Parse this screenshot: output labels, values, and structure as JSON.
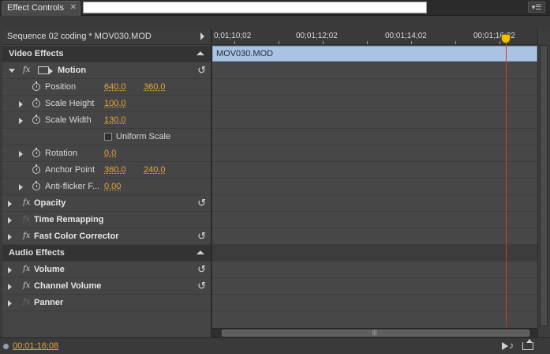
{
  "tab": {
    "title": "Effect Controls",
    "close": "✕",
    "menu": "▾☰"
  },
  "sequence": {
    "label": "Sequence 02 coding * MOV030.MOD"
  },
  "sections": {
    "video": "Video Effects",
    "audio": "Audio Effects"
  },
  "effects": {
    "motion": {
      "name": "Motion"
    },
    "opacity": {
      "name": "Opacity"
    },
    "time_remapping": {
      "name": "Time Remapping"
    },
    "fast_color": {
      "name": "Fast Color Corrector"
    },
    "volume": {
      "name": "Volume"
    },
    "channel_volume": {
      "name": "Channel Volume"
    },
    "panner": {
      "name": "Panner"
    }
  },
  "fx_label": "fx",
  "reset_glyph": "↺",
  "params": {
    "position": {
      "label": "Position",
      "v1": "640.0",
      "v2": "360.0"
    },
    "scale_height": {
      "label": "Scale Height",
      "v1": "100.0"
    },
    "scale_width": {
      "label": "Scale Width",
      "v1": "130.0"
    },
    "uniform_scale": {
      "label": "Uniform Scale",
      "checked": false
    },
    "rotation": {
      "label": "Rotation",
      "v1": "0.0"
    },
    "anchor_point": {
      "label": "Anchor Point",
      "v1": "360.0",
      "v2": "240.0"
    },
    "anti_flicker": {
      "label": "Anti-flicker F...",
      "v1": "0.00"
    }
  },
  "timeline": {
    "ticks": [
      "0;01;10;02",
      "00;01;12;02",
      "00;01;14;02",
      "00;01;16;02"
    ],
    "clip_name": "MOV030.MOD",
    "scroll_grip": "|||"
  },
  "status": {
    "timecode": "00;01;16;08"
  },
  "colors": {
    "accent_value": "#e8a63a",
    "playhead": "#d23a2a",
    "clip": "#a9c3e3"
  }
}
